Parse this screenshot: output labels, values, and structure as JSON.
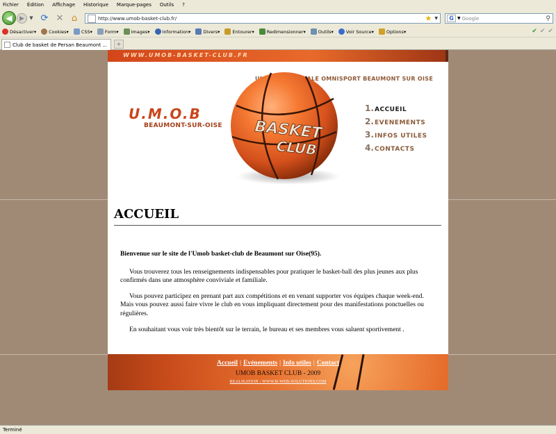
{
  "menu": [
    "Fichier",
    "Édition",
    "Affichage",
    "Historique",
    "Marque-pages",
    "Outils",
    "?"
  ],
  "navbar": {
    "url": "http://www.umob-basket-club.fr/",
    "search_placeholder": "Google"
  },
  "webdev_toolbar": [
    {
      "label": "Désactiver",
      "icon": "block-icon",
      "color": "#d9322b"
    },
    {
      "label": "Cookies",
      "icon": "cookie-icon",
      "color": "#a0744a"
    },
    {
      "label": "CSS",
      "icon": "css-icon",
      "color": "#7a9bc7"
    },
    {
      "label": "Form",
      "icon": "form-icon",
      "color": "#8aa0b8"
    },
    {
      "label": "Images",
      "icon": "image-icon",
      "color": "#6b8e5a"
    },
    {
      "label": "Information",
      "icon": "info-icon",
      "color": "#3a64b0"
    },
    {
      "label": "Divers",
      "icon": "misc-icon",
      "color": "#5a7ab0"
    },
    {
      "label": "Entourer",
      "icon": "pencil-icon",
      "color": "#c79a2a"
    },
    {
      "label": "Redimensionner",
      "icon": "resize-icon",
      "color": "#4a8a3a"
    },
    {
      "label": "Outils",
      "icon": "wrench-icon",
      "color": "#7090b0"
    },
    {
      "label": "Voir Source",
      "icon": "source-icon",
      "color": "#3a6ad0"
    },
    {
      "label": "Options",
      "icon": "options-icon",
      "color": "#d0a02a"
    }
  ],
  "tab": {
    "title": "Club de basket de Persan Beaumont ..."
  },
  "site": {
    "url_banner": "WWW.UMOB-BASKET-CLUB.FR",
    "union_title": "UNION MUNICIPALE OMNISPORT BEAUMONT SUR OISE",
    "logo": "U.M.O.B",
    "city": "BEAUMONT-SUR-OISE",
    "ball_text_1": "BASKET",
    "ball_text_2": "CLUB",
    "nav": [
      {
        "num": "1.",
        "label": "ACCUEIL"
      },
      {
        "num": "2.",
        "label": "EVENEMENTS"
      },
      {
        "num": "3.",
        "label": "INFOS UTILES"
      },
      {
        "num": "4.",
        "label": "CONTACTS"
      }
    ],
    "heading": "ACCUEIL",
    "intro": "Bienvenue sur le site de l'Umob basket-club de Beaumont sur Oise(95).",
    "p1": "Vous trouverez tous les renseignements indispensables pour pratiquer le basket-ball des plus jeunes aux plus confirmés dans une atmosphère conviviale et familiale.",
    "p2": "Vous pouvez participez en prenant part aux compétitions et en venant supporter vos équipes chaque week-end. Mais vous pouvez aussi faire vivre le club en vous impliquant directement pour des manifestations ponctuelles ou régulières.",
    "p3": "En souhaitant vous voir très bientôt sur le terrain, le bureau et ses membres vous saluent sportivement .",
    "footer_links": [
      "Accueil",
      "Evénements",
      "Info utiles",
      "Contact"
    ],
    "footer_copy": "UMOB BASKET CLUB - 2009",
    "footer_credit": "REALISATION : WWW.B-WEB-SOLUTIONS.COM"
  },
  "status": "Terminé"
}
